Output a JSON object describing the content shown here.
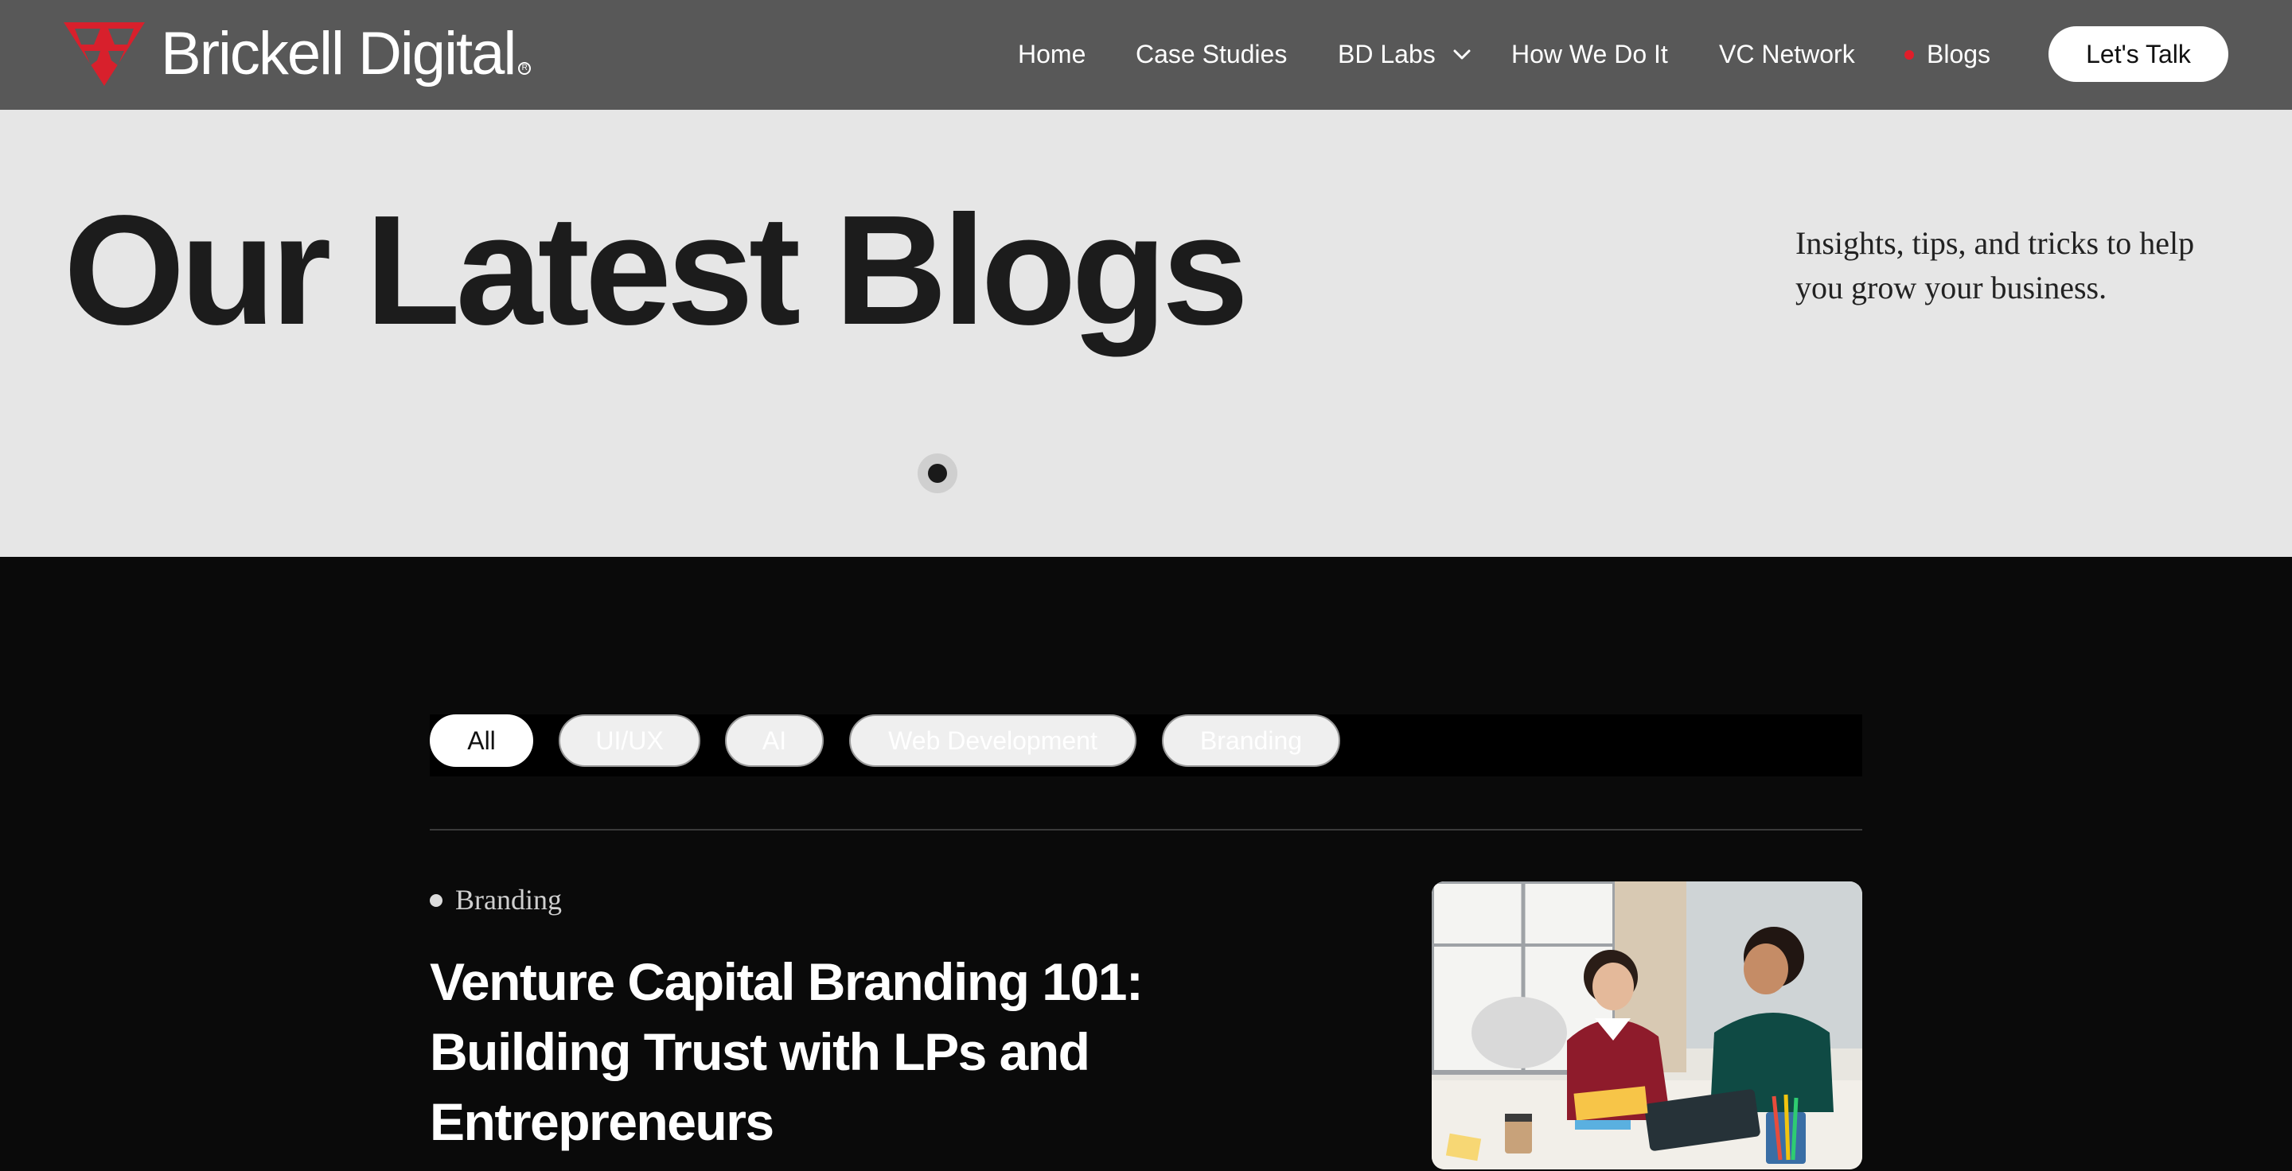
{
  "brand": {
    "name": "Brickell Digital",
    "reg_mark": "R",
    "accent": "#d8202c"
  },
  "nav": {
    "links": [
      "Home",
      "Case Studies",
      "BD Labs",
      "How We Do It",
      "VC Network",
      "Blogs"
    ],
    "active": "Blogs",
    "cta_label": "Let's Talk"
  },
  "hero": {
    "title": "Our Latest Blogs",
    "subtitle": "Insights, tips, and tricks to help you grow your business."
  },
  "filters": {
    "items": [
      "All",
      "UI/UX",
      "AI",
      "Web Development",
      "Branding"
    ],
    "active": "All"
  },
  "post": {
    "category": "Branding",
    "title": "Venture Capital Branding 101: Building Trust with LPs and Entrepreneurs"
  },
  "icons": {
    "logo": "bd-triangle-logo",
    "dropdown": "chevron-down-icon",
    "active_indicator": "red-dot"
  }
}
